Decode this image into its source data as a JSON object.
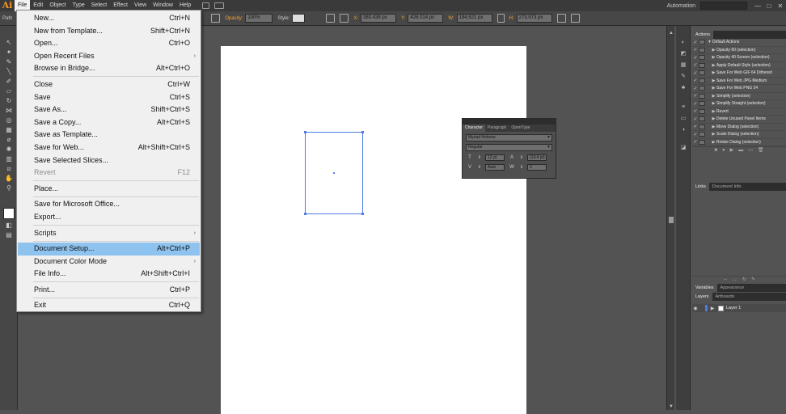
{
  "app": {
    "logo": "Ai",
    "menu": [
      "File",
      "Edit",
      "Object",
      "Type",
      "Select",
      "Effect",
      "View",
      "Window",
      "Help"
    ],
    "workspace": "Automation",
    "window_buttons": [
      "—",
      "□",
      "✕"
    ]
  },
  "control_bar": {
    "selection_label": "Path",
    "opacity_label": "Opacity:",
    "opacity_value": "100%",
    "style_label": "Style:",
    "x_label": "X:",
    "x_value": "380.438 px",
    "y_label": "Y:",
    "y_value": "426.014 px",
    "w_label": "W:",
    "w_value": "194.521 px",
    "h_label": "H:",
    "h_value": "273.973 px"
  },
  "file_menu": {
    "items": [
      {
        "label": "New...",
        "shortcut": "Ctrl+N"
      },
      {
        "label": "New from Template...",
        "shortcut": "Shift+Ctrl+N"
      },
      {
        "label": "Open...",
        "shortcut": "Ctrl+O"
      },
      {
        "label": "Open Recent Files",
        "shortcut": "",
        "submenu": true
      },
      {
        "label": "Browse in Bridge...",
        "shortcut": "Alt+Ctrl+O",
        "sep_after": true
      },
      {
        "label": "Close",
        "shortcut": "Ctrl+W"
      },
      {
        "label": "Save",
        "shortcut": "Ctrl+S"
      },
      {
        "label": "Save As...",
        "shortcut": "Shift+Ctrl+S"
      },
      {
        "label": "Save a Copy...",
        "shortcut": "Alt+Ctrl+S"
      },
      {
        "label": "Save as Template..."
      },
      {
        "label": "Save for Web...",
        "shortcut": "Alt+Shift+Ctrl+S"
      },
      {
        "label": "Save Selected Slices..."
      },
      {
        "label": "Revert",
        "shortcut": "F12",
        "disabled": true,
        "sep_after": true
      },
      {
        "label": "Place...",
        "sep_after": true
      },
      {
        "label": "Save for Microsoft Office..."
      },
      {
        "label": "Export...",
        "sep_after": true
      },
      {
        "label": "Scripts",
        "submenu": true,
        "sep_after": true
      },
      {
        "label": "Document Setup...",
        "shortcut": "Alt+Ctrl+P",
        "highlighted": true
      },
      {
        "label": "Document Color Mode",
        "submenu": true
      },
      {
        "label": "File Info...",
        "shortcut": "Alt+Shift+Ctrl+I",
        "sep_after": true
      },
      {
        "label": "Print...",
        "shortcut": "Ctrl+P",
        "sep_after": true
      },
      {
        "label": "Exit",
        "shortcut": "Ctrl+Q"
      }
    ]
  },
  "character_panel": {
    "tabs": [
      "Character",
      "Paragraph",
      "OpenType"
    ],
    "font_family": "Myriad Hebrew",
    "font_style": "Regular",
    "font_size": "12 pt",
    "leading": "(14.4 pt)",
    "kerning": "Auto",
    "tracking": "0"
  },
  "actions_panel": {
    "tab": "Actions",
    "set_name": "Default Actions",
    "actions": [
      "Opacity 60 (selection)",
      "Opacity 40 Screen (selection)",
      "Apply Default Style (selection)",
      "Save For Web GIF 64 Dithered",
      "Save For Web JPG Medium",
      "Save For Web PNG 24",
      "Simplify (selection)",
      "Simplify Straight (selection)",
      "Revert",
      "Delete Unused Panel Items",
      "Move Dialog (selection)",
      "Scale Dialog (selection)",
      "Rotate Dialog (selection)"
    ]
  },
  "links_panel": {
    "tabs": [
      "Links",
      "Document Info"
    ]
  },
  "variables_panel": {
    "tabs": [
      "Variables",
      "Appearance"
    ]
  },
  "layers_panel": {
    "tabs": [
      "Layers",
      "Artboards"
    ],
    "layer_name": "Layer 1"
  }
}
